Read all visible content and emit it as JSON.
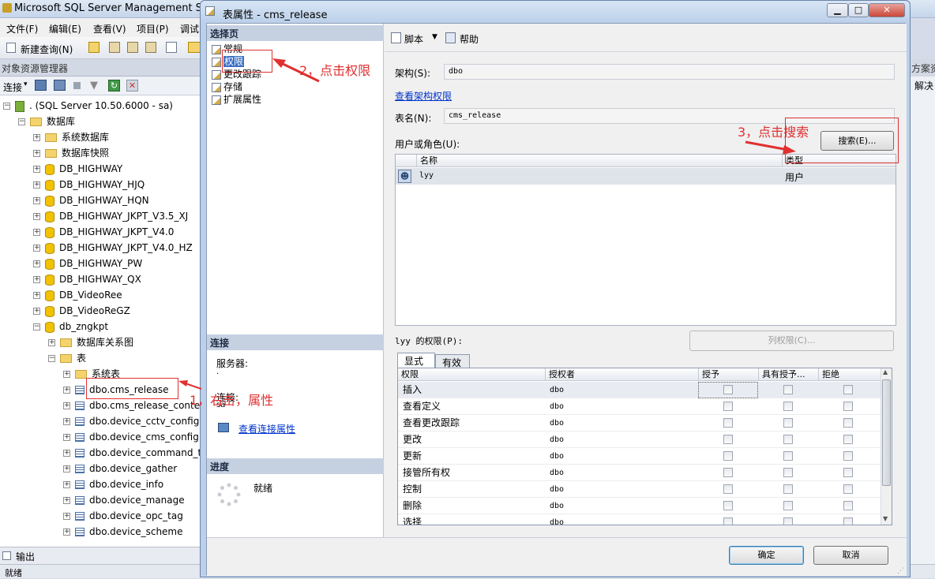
{
  "ssms": {
    "title": "Microsoft SQL Server Management Studio",
    "menu": [
      "文件(F)",
      "编辑(E)",
      "查看(V)",
      "项目(P)",
      "调试"
    ],
    "toolbar_new_query": "新建查询(N)",
    "oe_header": "对象资源管理器",
    "oe_connect": "连接",
    "right_strip_header": "方案资",
    "right_strip_item": "解决",
    "output_tab": "输出",
    "status": "就绪"
  },
  "tree": {
    "server": ". (SQL Server 10.50.6000 - sa)",
    "databases": "数据库",
    "system_dbs": "系统数据库",
    "snapshots": "数据库快照",
    "db_items": [
      "DB_HIGHWAY",
      "DB_HIGHWAY_HJQ",
      "DB_HIGHWAY_HQN",
      "DB_HIGHWAY_JKPT_V3.5_XJ",
      "DB_HIGHWAY_JKPT_V4.0",
      "DB_HIGHWAY_JKPT_V4.0_HZ",
      "DB_HIGHWAY_PW",
      "DB_HIGHWAY_QX",
      "DB_VideoRee",
      "DB_VideoReGZ",
      "db_zngkpt"
    ],
    "diagrams": "数据库关系图",
    "tables": "表",
    "system_tables": "系统表",
    "table_items": [
      "dbo.cms_release",
      "dbo.cms_release_conte",
      "dbo.device_cctv_config",
      "dbo.device_cms_config",
      "dbo.device_command_t",
      "dbo.device_gather",
      "dbo.device_info",
      "dbo.device_manage",
      "dbo.device_opc_tag",
      "dbo.device_scheme"
    ]
  },
  "dialog": {
    "title": "表属性 - cms_release",
    "select_page_header": "选择页",
    "pages": [
      "常规",
      "权限",
      "更改跟踪",
      "存储",
      "扩展属性"
    ],
    "selected_page": "权限",
    "connection_header": "连接",
    "server_label": "服务器:",
    "server_value": ".",
    "conn_label": "连接:",
    "conn_value": "sa",
    "view_conn_props": "查看连接属性",
    "progress_header": "进度",
    "progress_status": "就绪",
    "script_label": "脚本",
    "help_label": "帮助",
    "schema_label": "架构(S):",
    "schema_value": "dbo",
    "view_schema_perms": "查看架构权限",
    "table_name_label": "表名(N):",
    "table_name_value": "cms_release",
    "users_label": "用户或角色(U):",
    "search_button": "搜索(E)...",
    "users_columns": [
      "名称",
      "类型"
    ],
    "users": [
      {
        "name": "lyy",
        "type": "用户"
      }
    ],
    "perms_label": "lyy 的权限(P):",
    "column_perms_button": "列权限(C)...",
    "tabs": [
      "显式",
      "有效"
    ],
    "perm_columns": [
      "权限",
      "授权者",
      "授予",
      "具有授予...",
      "拒绝"
    ],
    "permissions": [
      {
        "name": "插入",
        "grantor": "dbo"
      },
      {
        "name": "查看定义",
        "grantor": "dbo"
      },
      {
        "name": "查看更改跟踪",
        "grantor": "dbo"
      },
      {
        "name": "更改",
        "grantor": "dbo"
      },
      {
        "name": "更新",
        "grantor": "dbo"
      },
      {
        "name": "接管所有权",
        "grantor": "dbo"
      },
      {
        "name": "控制",
        "grantor": "dbo"
      },
      {
        "name": "删除",
        "grantor": "dbo"
      },
      {
        "name": "选择",
        "grantor": "dbo"
      }
    ],
    "ok_button": "确定",
    "cancel_button": "取消"
  },
  "annotations": {
    "step1": "1，右击，属性",
    "step2": "2，点击权限",
    "step3": "3，点击搜索",
    "color": "#e03030"
  }
}
